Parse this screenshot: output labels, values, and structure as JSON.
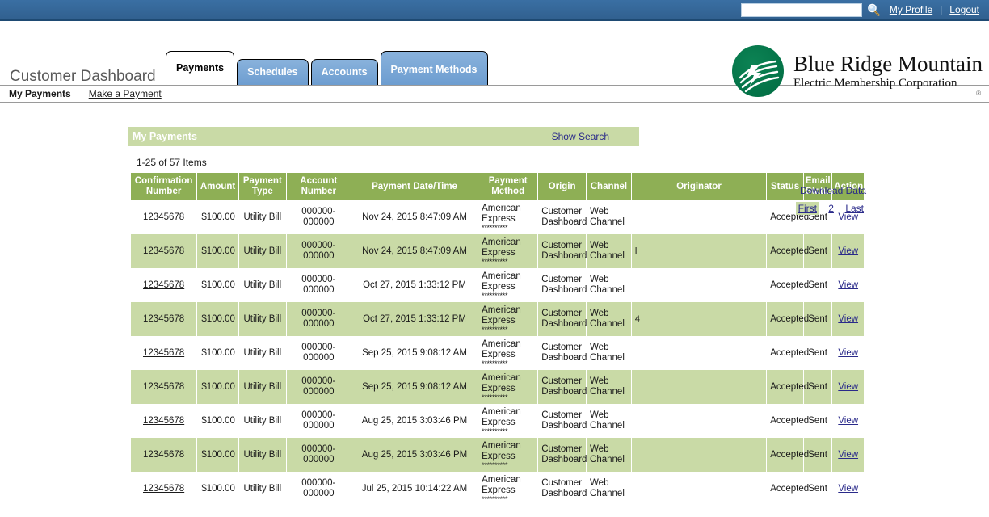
{
  "topbar": {
    "search_value": "",
    "search_placeholder": "",
    "search_icon": "search-icon",
    "my_profile": "My Profile",
    "separator": "|",
    "logout": "Logout"
  },
  "header": {
    "page_title": "Customer Dashboard",
    "logo": {
      "line1": "Blue Ridge Mountain",
      "line2": "Electric Membership Corporation",
      "registered_mark": "®",
      "color": "#00774a"
    },
    "tabs": [
      {
        "label": "Payments",
        "active": true
      },
      {
        "label": "Schedules",
        "active": false
      },
      {
        "label": "Accounts",
        "active": false
      },
      {
        "label": "Payment Methods",
        "active": false
      }
    ]
  },
  "subnav": {
    "items": [
      {
        "label": "My Payments",
        "current": true
      },
      {
        "label": "Make a Payment",
        "current": false
      }
    ]
  },
  "panel": {
    "title": "My Payments",
    "show_search": "Show Search",
    "banner_color": "#c9daa6"
  },
  "toolbar": {
    "download_data": "Download Data",
    "pager": [
      {
        "label": "First",
        "current": true
      },
      {
        "label": "2",
        "current": false
      },
      {
        "label": "Last",
        "current": false
      }
    ]
  },
  "grid": {
    "items_count": "1-25 of 57 Items",
    "header_color": "#8eaf55",
    "columns": [
      "Confirmation Number",
      "Amount",
      "Payment Type",
      "Account Number",
      "Payment Date/Time",
      "Payment Method",
      "Origin",
      "Channel",
      "Originator",
      "Status",
      "Email Status",
      "Action"
    ],
    "rows": [
      {
        "confirmation": "12345678",
        "amount": "$100.00",
        "payment_type": "Utility Bill",
        "account_number": "000000-000000",
        "payment_datetime": "Nov 24, 2015 8:47:09 AM",
        "payment_method": "American Express",
        "payment_method_mask": "**********",
        "origin": "Customer Dashboard",
        "channel": "Web Channel",
        "originator": "",
        "status": "Accepted",
        "email_status": "Sent",
        "action": "View"
      },
      {
        "confirmation": "12345678",
        "amount": "$100.00",
        "payment_type": "Utility Bill",
        "account_number": "000000-000000",
        "payment_datetime": "Nov 24, 2015 8:47:09 AM",
        "payment_method": "American Express",
        "payment_method_mask": "**********",
        "origin": "Customer Dashboard",
        "channel": "Web Channel",
        "originator": "l",
        "status": "Accepted",
        "email_status": "Sent",
        "action": "View"
      },
      {
        "confirmation": "12345678",
        "amount": "$100.00",
        "payment_type": "Utility Bill",
        "account_number": "000000-000000",
        "payment_datetime": "Oct 27, 2015 1:33:12 PM",
        "payment_method": "American Express",
        "payment_method_mask": "**********",
        "origin": "Customer Dashboard",
        "channel": "Web Channel",
        "originator": "",
        "status": "Accepted",
        "email_status": "Sent",
        "action": "View"
      },
      {
        "confirmation": "12345678",
        "amount": "$100.00",
        "payment_type": "Utility Bill",
        "account_number": "000000-000000",
        "payment_datetime": "Oct 27, 2015 1:33:12 PM",
        "payment_method": "American Express",
        "payment_method_mask": "**********",
        "origin": "Customer Dashboard",
        "channel": "Web Channel",
        "originator": "4",
        "status": "Accepted",
        "email_status": "Sent",
        "action": "View"
      },
      {
        "confirmation": "12345678",
        "amount": "$100.00",
        "payment_type": "Utility Bill",
        "account_number": "000000-000000",
        "payment_datetime": "Sep 25, 2015 9:08:12 AM",
        "payment_method": "American Express",
        "payment_method_mask": "**********",
        "origin": "Customer Dashboard",
        "channel": "Web Channel",
        "originator": "",
        "status": "Accepted",
        "email_status": "Sent",
        "action": "View"
      },
      {
        "confirmation": "12345678",
        "amount": "$100.00",
        "payment_type": "Utility Bill",
        "account_number": "000000-000000",
        "payment_datetime": "Sep 25, 2015 9:08:12 AM",
        "payment_method": "American Express",
        "payment_method_mask": "**********",
        "origin": "Customer Dashboard",
        "channel": "Web Channel",
        "originator": "",
        "status": "Accepted",
        "email_status": "Sent",
        "action": "View"
      },
      {
        "confirmation": "12345678",
        "amount": "$100.00",
        "payment_type": "Utility Bill",
        "account_number": "000000-000000",
        "payment_datetime": "Aug 25, 2015 3:03:46 PM",
        "payment_method": "American Express",
        "payment_method_mask": "**********",
        "origin": "Customer Dashboard",
        "channel": "Web Channel",
        "originator": "",
        "status": "Accepted",
        "email_status": "Sent",
        "action": "View"
      },
      {
        "confirmation": "12345678",
        "amount": "$100.00",
        "payment_type": "Utility Bill",
        "account_number": "000000-000000",
        "payment_datetime": "Aug 25, 2015 3:03:46 PM",
        "payment_method": "American Express",
        "payment_method_mask": "**********",
        "origin": "Customer Dashboard",
        "channel": "Web Channel",
        "originator": "",
        "status": "Accepted",
        "email_status": "Sent",
        "action": "View"
      },
      {
        "confirmation": "12345678",
        "amount": "$100.00",
        "payment_type": "Utility Bill",
        "account_number": "000000-000000",
        "payment_datetime": "Jul 25, 2015 10:14:22 AM",
        "payment_method": "American Express",
        "payment_method_mask": "**********",
        "origin": "Customer Dashboard",
        "channel": "Web Channel",
        "originator": "",
        "status": "Accepted",
        "email_status": "Sent",
        "action": "View"
      }
    ]
  }
}
